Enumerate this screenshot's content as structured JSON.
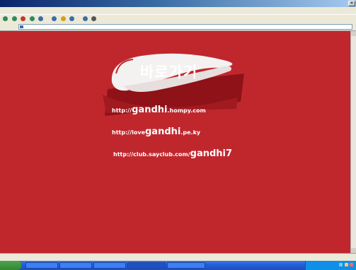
{
  "window": {
    "title": "",
    "close_symbol": "✕"
  },
  "menu": {
    "items": [
      "",
      "",
      "",
      "",
      "",
      ""
    ]
  },
  "toolbar": {
    "icons": [
      "back-icon",
      "forward-icon",
      "stop-icon",
      "refresh-icon",
      "home-icon",
      "search-icon",
      "favorites-icon",
      "history-icon",
      "mail-icon",
      "print-icon"
    ],
    "icon_colors": [
      "#2e8b57",
      "#2e8b57",
      "#c0392b",
      "#2e8b57",
      "#3a6ea5",
      "#3a6ea5",
      "#d4a017",
      "#3a6ea5",
      "#3a6ea5",
      "#555555"
    ]
  },
  "address": {
    "label": "",
    "value": ""
  },
  "page": {
    "background_color": "#c0272d",
    "logo_text": "바로가기",
    "links": [
      {
        "caption": "",
        "url_prefix": "http://",
        "url_big": "gandhi",
        "url_suffix": ".hompy.com"
      },
      {
        "caption": "",
        "url_prefix": "http://love",
        "url_big": "gandhi",
        "url_suffix": ".pe.ky"
      },
      {
        "caption": "",
        "url_prefix": "http://club.sayclub.com/",
        "url_big": "gandhi7",
        "url_suffix": ""
      }
    ],
    "footnote": ""
  },
  "statusbar": {
    "left": "",
    "zone": ""
  },
  "taskbar": {
    "start_label": "",
    "tasks": [
      "",
      "",
      "",
      "",
      ""
    ],
    "clock": ""
  }
}
